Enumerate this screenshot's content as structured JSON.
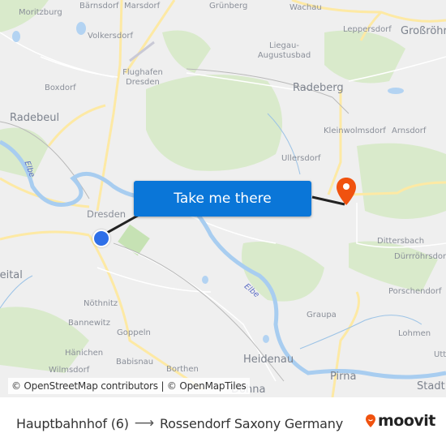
{
  "map": {
    "places": [
      {
        "name": "Moritzburg",
        "size": "small"
      },
      {
        "name": "Bärnsdorf",
        "size": "small"
      },
      {
        "name": "Marsdorf",
        "size": "small"
      },
      {
        "name": "Grünberg",
        "size": "small"
      },
      {
        "name": "Wachau",
        "size": "small"
      },
      {
        "name": "Leppersdorf",
        "size": "small"
      },
      {
        "name": "Großröhrsdorf",
        "size": "big"
      },
      {
        "name": "Volkersdorf",
        "size": "small"
      },
      {
        "name": "Flughafen Dresden",
        "size": "small"
      },
      {
        "name": "Liegau-Augustusbad",
        "size": "small"
      },
      {
        "name": "Boxdorf",
        "size": "small"
      },
      {
        "name": "Radeberg",
        "size": "big"
      },
      {
        "name": "Radebeul",
        "size": "big"
      },
      {
        "name": "Kleinwolmsdorf",
        "size": "small"
      },
      {
        "name": "Arnsdorf",
        "size": "small"
      },
      {
        "name": "Ullersdorf",
        "size": "small"
      },
      {
        "name": "Dresden",
        "size": "big"
      },
      {
        "name": "Dittersbach",
        "size": "small"
      },
      {
        "name": "Freital",
        "size": "big"
      },
      {
        "name": "Dürrröhrsdorf",
        "size": "small"
      },
      {
        "name": "Porschendorf",
        "size": "small"
      },
      {
        "name": "Nöthnitz",
        "size": "small"
      },
      {
        "name": "Bannewitz",
        "size": "small"
      },
      {
        "name": "Goppeln",
        "size": "small"
      },
      {
        "name": "Graupa",
        "size": "small"
      },
      {
        "name": "Lohmen",
        "size": "small"
      },
      {
        "name": "Hänichen",
        "size": "small"
      },
      {
        "name": "Babisnau",
        "size": "small"
      },
      {
        "name": "Heidenau",
        "size": "big"
      },
      {
        "name": "Wilmsdorf",
        "size": "small"
      },
      {
        "name": "Borthen",
        "size": "small"
      },
      {
        "name": "Pirna",
        "size": "big"
      },
      {
        "name": "Stadt",
        "size": "big"
      },
      {
        "name": "Dohna",
        "size": "big"
      },
      {
        "name": "Utte",
        "size": "small"
      }
    ],
    "rivers": [
      "Elbe",
      "Elbe"
    ],
    "cta_label": "Take me there",
    "attribution": "© OpenStreetMap contributors | © OpenMapTiles",
    "origin_marker": "origin-dot",
    "destination_marker": "destination-pin",
    "colors": {
      "route": "#222222",
      "origin": "#2e6fe8",
      "destination": "#f0520f",
      "cta": "#0a76d8",
      "water": "#a8cdf0",
      "forest": "#d6e8c6",
      "road": "#fde9a4"
    }
  },
  "footer": {
    "origin": "Hauptbahnhof (6)",
    "arrow": "⟶",
    "destination": "Rossendorf Saxony Germany",
    "brand": "moovit",
    "brand_color": "#f0520f"
  }
}
